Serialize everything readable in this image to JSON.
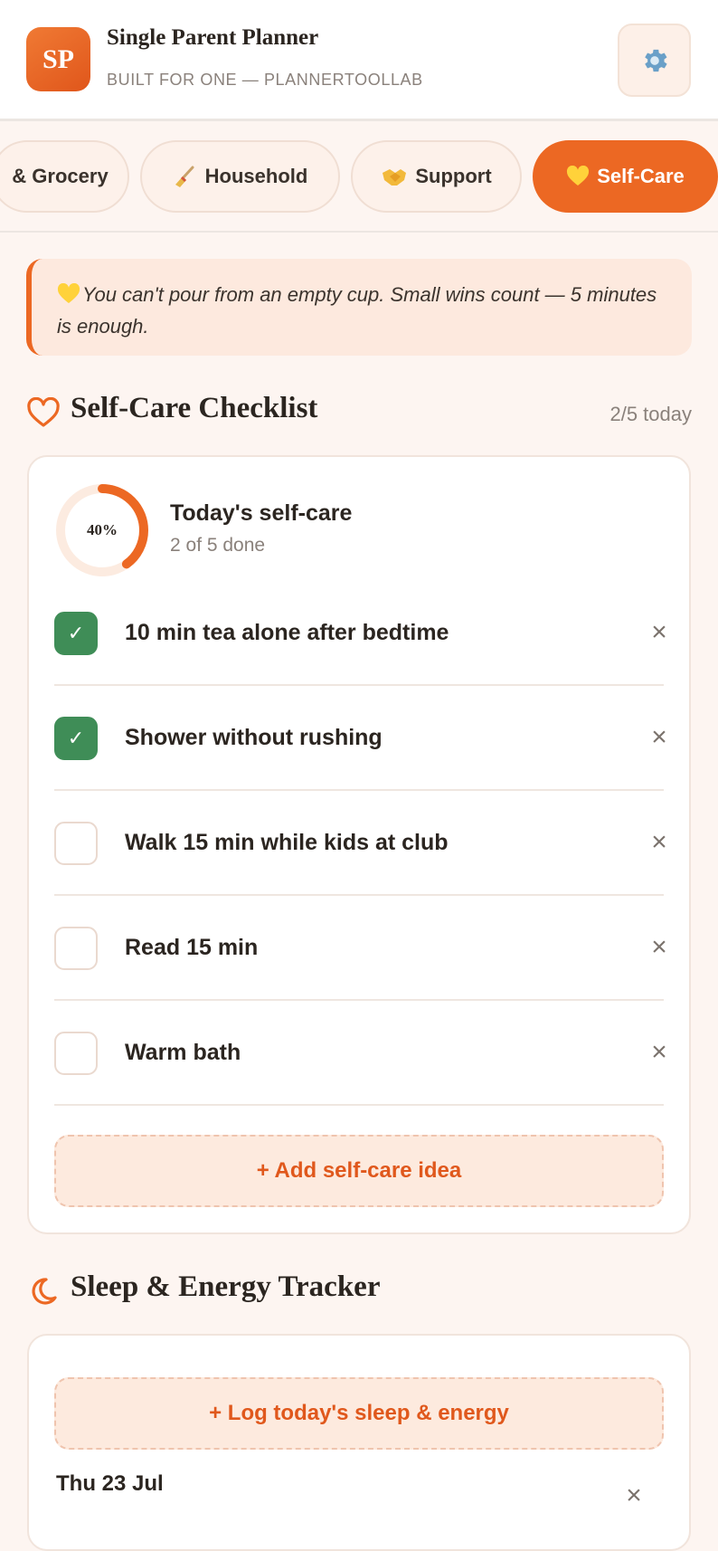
{
  "header": {
    "logo_text": "SP",
    "title": "Single Parent Planner",
    "subtitle": "BUILT FOR ONE — PLANNERTOOLLAB"
  },
  "tabs": [
    {
      "label": "& Grocery",
      "emoji": ""
    },
    {
      "label": "Household",
      "emoji": "broom"
    },
    {
      "label": "Support",
      "emoji": "handshake"
    },
    {
      "label": "Self-Care",
      "emoji": "yellow-heart",
      "active": true
    }
  ],
  "tip": {
    "text": "You can't pour from an empty cup. Small wins count — 5 minutes is enough."
  },
  "self_care": {
    "title": "Self-Care Checklist",
    "count": "2/5 today",
    "progress": {
      "percent_label": "40%",
      "fraction": 0.4,
      "title": "Today's self-care",
      "subtitle": "2 of 5 done"
    },
    "items": [
      {
        "label": "10 min tea alone after bedtime",
        "checked": true
      },
      {
        "label": "Shower without rushing",
        "checked": true
      },
      {
        "label": "Walk 15 min while kids at club",
        "checked": false
      },
      {
        "label": "Read 15 min",
        "checked": false
      },
      {
        "label": "Warm bath",
        "checked": false
      }
    ],
    "add_button": "+ Add self-care idea"
  },
  "sleep": {
    "title": "Sleep & Energy Tracker",
    "log_button": "+ Log today's sleep & energy",
    "entries": [
      {
        "date": "Thu 23 Jul"
      }
    ]
  },
  "icons": {
    "checkmark": "✓",
    "delete": "×"
  },
  "colors": {
    "accent": "#ec6823",
    "checked": "#3f8d57",
    "background": "#fdf5f1"
  }
}
